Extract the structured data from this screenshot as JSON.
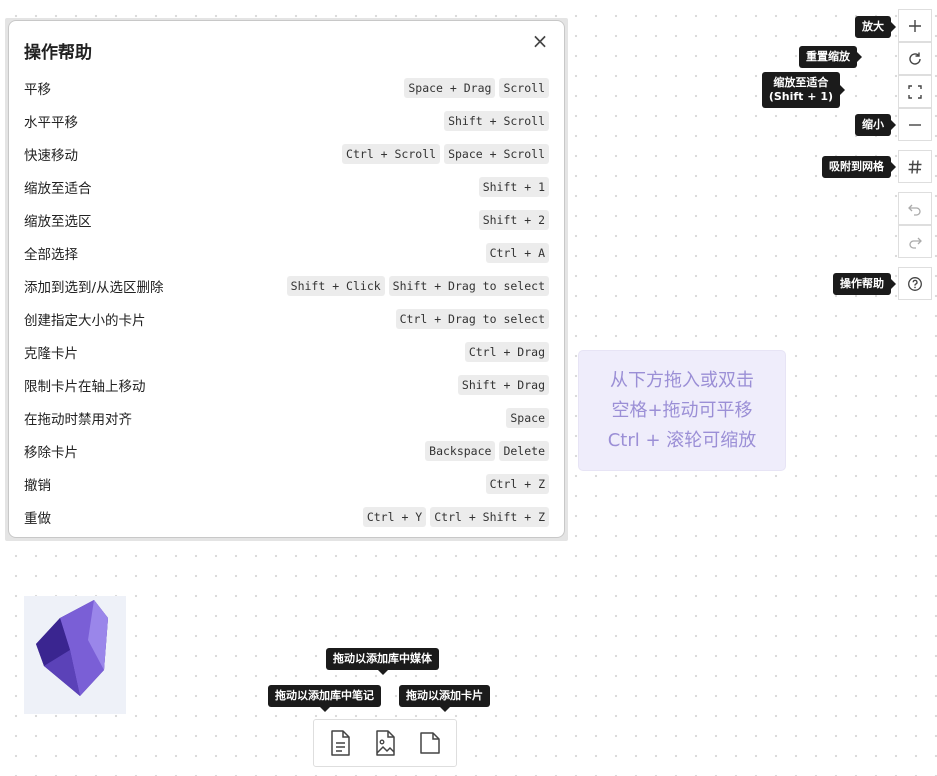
{
  "help": {
    "title": "操作帮助",
    "close_icon": "×",
    "rows": [
      {
        "label": "平移",
        "keys": [
          "Space + Drag",
          "Scroll"
        ]
      },
      {
        "label": "水平平移",
        "keys": [
          "Shift + Scroll"
        ]
      },
      {
        "label": "快速移动",
        "keys": [
          "Ctrl + Scroll",
          "Space + Scroll"
        ]
      },
      {
        "label": "缩放至适合",
        "keys": [
          "Shift + 1"
        ]
      },
      {
        "label": "缩放至选区",
        "keys": [
          "Shift + 2"
        ]
      },
      {
        "label": "全部选择",
        "keys": [
          "Ctrl + A"
        ]
      },
      {
        "label": "添加到选到/从选区删除",
        "keys": [
          "Shift + Click",
          "Shift + Drag to select"
        ]
      },
      {
        "label": "创建指定大小的卡片",
        "keys": [
          "Ctrl + Drag to select"
        ]
      },
      {
        "label": "克隆卡片",
        "keys": [
          "Ctrl + Drag"
        ]
      },
      {
        "label": "限制卡片在轴上移动",
        "keys": [
          "Shift + Drag"
        ]
      },
      {
        "label": "在拖动时禁用对齐",
        "keys": [
          "Space"
        ]
      },
      {
        "label": "移除卡片",
        "keys": [
          "Backspace",
          "Delete"
        ]
      },
      {
        "label": "撤销",
        "keys": [
          "Ctrl + Z"
        ]
      },
      {
        "label": "重做",
        "keys": [
          "Ctrl + Y",
          "Ctrl + Shift + Z"
        ]
      }
    ]
  },
  "hint": {
    "line1": "从下方拖入或双击",
    "line2": "空格+拖动可平移",
    "line3": "Ctrl + 滚轮可缩放"
  },
  "toolbar": {
    "zoom_in_tip": "放大",
    "reset_zoom_tip": "重置缩放",
    "zoom_fit_tip_line1": "缩放至适合",
    "zoom_fit_tip_line2": "(Shift + 1)",
    "zoom_out_tip": "缩小",
    "snap_grid_tip": "吸附到网格",
    "help_tip": "操作帮助"
  },
  "bottom_bar": {
    "media_tip": "拖动以添加库中媒体",
    "note_tip": "拖动以添加库中笔记",
    "card_tip": "拖动以添加卡片"
  },
  "colors": {
    "hint_text": "#9b8fd6",
    "hint_bg": "#efedfb",
    "tooltip_bg": "#1b1b1b",
    "logo_dark": "#4a33a0",
    "logo_light": "#8f78e6"
  }
}
